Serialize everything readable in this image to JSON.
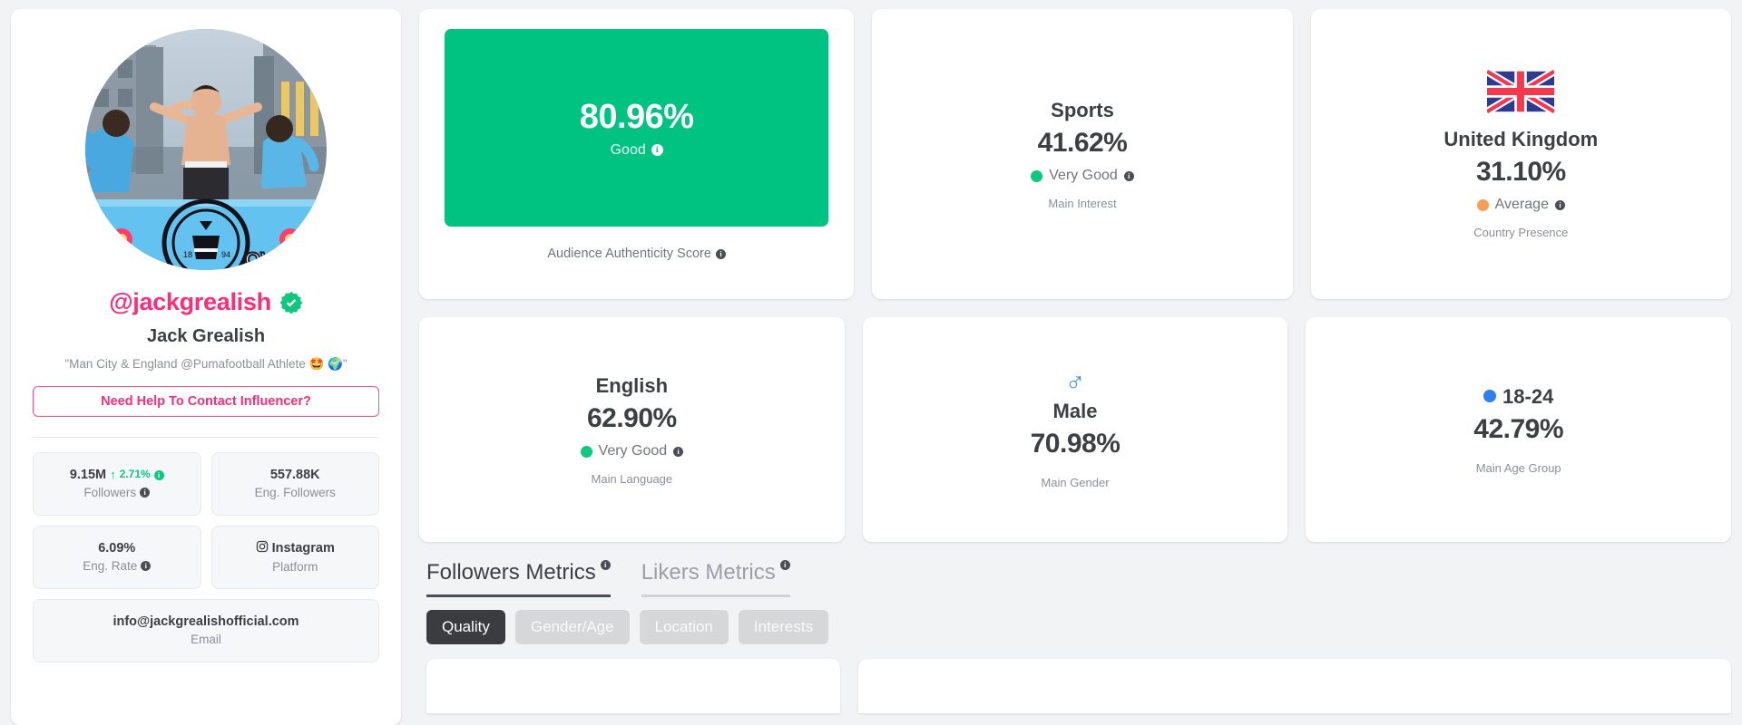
{
  "profile": {
    "avatar_alt": "Jack Grealish shirtless on Manchester City victory parade bus",
    "handle": "@jackgrealish",
    "verified": true,
    "full_name": "Jack Grealish",
    "bio": "\"Man City & England @Pumafootball Athlete 🤩 🌍\"",
    "contact_button": "Need Help To Contact Influencer?",
    "stats": [
      {
        "name": "followers",
        "value": "9.15M",
        "delta": "2.71%",
        "delta_direction": "up",
        "label": "Followers",
        "has_info": true,
        "has_value_info": true
      },
      {
        "name": "engaged-followers",
        "value": "557.88K",
        "label": "Eng. Followers",
        "has_info": false,
        "has_value_info": false
      },
      {
        "name": "engagement-rate",
        "value": "6.09%",
        "label": "Eng. Rate",
        "has_info": true,
        "has_value_info": false
      },
      {
        "name": "platform",
        "value": "Instagram",
        "label": "Platform",
        "icon": "instagram-icon",
        "has_info": false,
        "has_value_info": false
      },
      {
        "name": "email",
        "value": "info@jackgrealishofficial.com",
        "label": "Email",
        "has_info": false,
        "has_value_info": false,
        "full_width": true
      }
    ]
  },
  "kpis": {
    "authenticity": {
      "value": "80.96%",
      "rating": "Good",
      "caption": "Audience Authenticity Score",
      "block_color": "#00c281"
    },
    "interest": {
      "title": "Sports",
      "value": "41.62%",
      "rating": "Very Good",
      "rating_color": "#11c77f",
      "caption": "Main Interest"
    },
    "country": {
      "flag": "united-kingdom-flag-icon",
      "title": "United Kingdom",
      "value": "31.10%",
      "rating": "Average",
      "rating_color": "#f79e56",
      "caption": "Country Presence"
    },
    "language": {
      "title": "English",
      "value": "62.90%",
      "rating": "Very Good",
      "rating_color": "#11c77f",
      "caption": "Main Language"
    },
    "gender": {
      "icon": "male-gender-icon",
      "title": "Male",
      "value": "70.98%",
      "caption": "Main Gender"
    },
    "age": {
      "title": "18-24",
      "dot_color": "#2f80ed",
      "value": "42.79%",
      "caption": "Main Age Group"
    }
  },
  "metrics": {
    "tabs": [
      {
        "label": "Followers Metrics",
        "active": true,
        "has_info": true
      },
      {
        "label": "Likers Metrics",
        "active": false,
        "has_info": true
      }
    ],
    "pills": [
      {
        "label": "Quality",
        "active": true
      },
      {
        "label": "Gender/Age",
        "active": false
      },
      {
        "label": "Location",
        "active": false
      },
      {
        "label": "Interests",
        "active": false
      }
    ]
  },
  "colors": {
    "brand_pink": "#ff2d78",
    "green": "#00c281",
    "orange": "#f79e56",
    "blue": "#2f80ed",
    "page_bg": "#f2f3f5"
  }
}
